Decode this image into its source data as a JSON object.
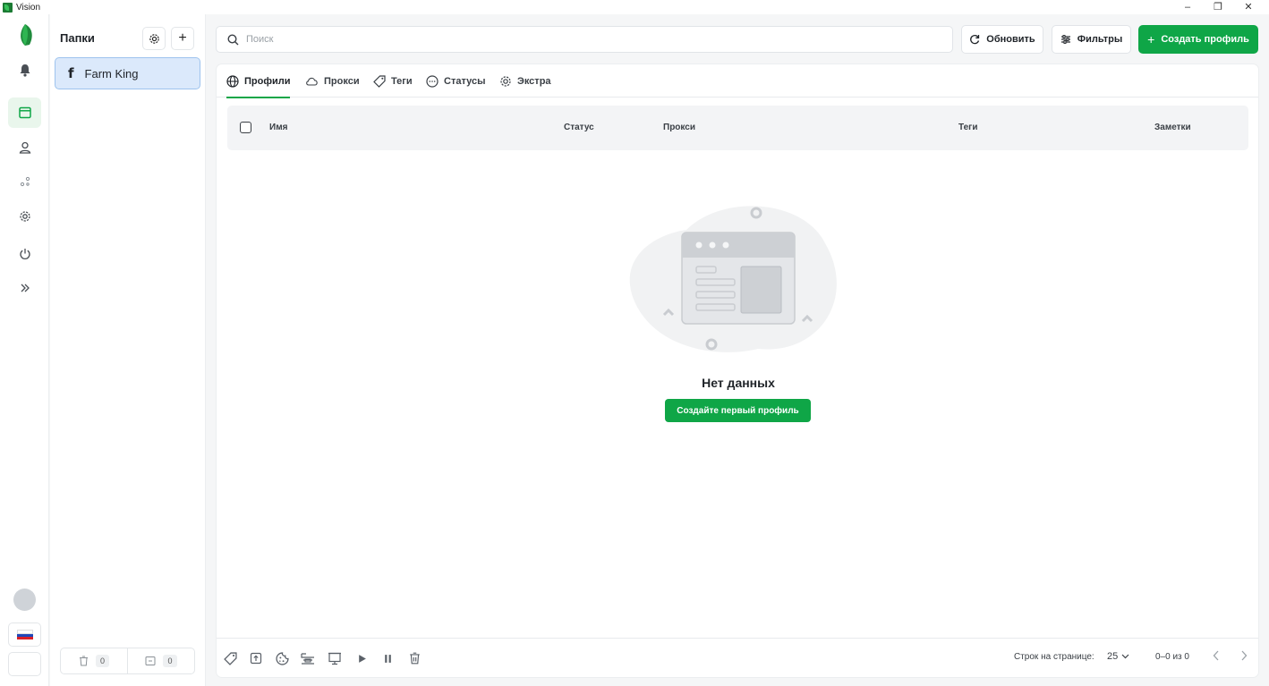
{
  "window": {
    "title": "Vision",
    "controls": [
      "–",
      "❐",
      "✕"
    ]
  },
  "rail": {
    "items": [
      "logo",
      "bell-icon",
      "profiles-icon",
      "user-icon",
      "share-icon",
      "gear-icon",
      "power-icon",
      "expand-icon"
    ],
    "active": "profiles-icon",
    "language_flag": "ru"
  },
  "folders": {
    "title": "Папки",
    "items": [
      {
        "label": "Farm King",
        "icon": "facebook-icon"
      }
    ],
    "trash_count": "0",
    "archive_count": "0"
  },
  "search": {
    "placeholder": "Поиск",
    "value": ""
  },
  "toolbar": {
    "refresh_label": "Обновить",
    "filters_label": "Фильтры",
    "create_label": "Создать профиль"
  },
  "tabs": [
    {
      "label": "Профили",
      "icon": "globe-icon",
      "active": true
    },
    {
      "label": "Прокси",
      "icon": "cloud-icon"
    },
    {
      "label": "Теги",
      "icon": "tag-icon"
    },
    {
      "label": "Статусы",
      "icon": "dots-circle-icon"
    },
    {
      "label": "Экстра",
      "icon": "gear-icon"
    }
  ],
  "table": {
    "columns": [
      "Имя",
      "Статус",
      "Прокси",
      "Теги",
      "Заметки"
    ],
    "rows": []
  },
  "empty": {
    "title": "Нет данных",
    "button": "Создайте первый профиль"
  },
  "footer": {
    "rows_per_page_label": "Строк на странице:",
    "rows_per_page": "25",
    "range": "0–0 из 0"
  },
  "colors": {
    "accent": "#0fa647",
    "folder_selected_bg": "#dbe9fb",
    "folder_selected_border": "#9ec3ee"
  }
}
